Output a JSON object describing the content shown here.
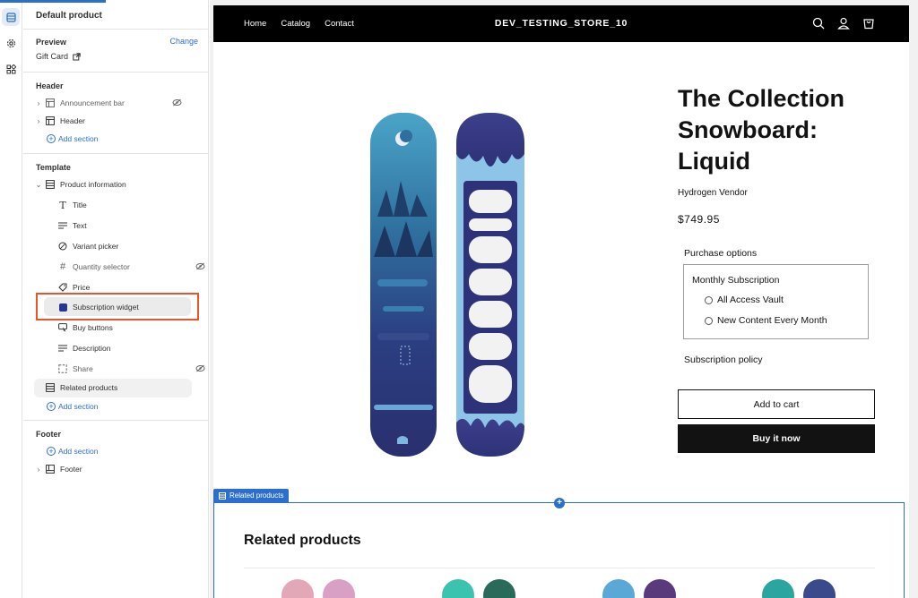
{
  "rail": {
    "items": [
      {
        "name": "sections-icon",
        "active": true
      },
      {
        "name": "settings-icon",
        "active": false
      },
      {
        "name": "apps-icon",
        "active": false
      }
    ]
  },
  "sidebar": {
    "title": "Default product",
    "preview": {
      "label": "Preview",
      "change_label": "Change",
      "value": "Gift Card"
    },
    "header_group": {
      "label": "Header",
      "items": [
        "Announcement bar",
        "Header"
      ],
      "add_label": "Add section"
    },
    "template_group": {
      "label": "Template",
      "section": "Product information",
      "blocks": [
        "Title",
        "Text",
        "Variant picker",
        "Quantity selector",
        "Price",
        "Subscription widget",
        "Buy buttons",
        "Description",
        "Share"
      ],
      "related": "Related products",
      "add_label": "Add section"
    },
    "footer_group": {
      "label": "Footer",
      "add_label": "Add section",
      "item": "Footer"
    }
  },
  "store": {
    "nav": [
      "Home",
      "Catalog",
      "Contact"
    ],
    "name": "DEV_TESTING_STORE_10",
    "product": {
      "title": "The Collection Snowboard: Liquid",
      "vendor": "Hydrogen Vendor",
      "price": "$749.95",
      "purchase_options_label": "Purchase options",
      "subscription_heading": "Monthly Subscription",
      "options": [
        "All Access Vault",
        "New Content Every Month"
      ],
      "policy_label": "Subscription policy",
      "add_to_cart": "Add to cart",
      "buy_now": "Buy it now"
    },
    "related": {
      "tag": "Related products",
      "title": "Related products"
    }
  },
  "colors": {
    "accent": "#2c6ecb",
    "highlight": "#e8542c",
    "storebar": "#000000"
  }
}
